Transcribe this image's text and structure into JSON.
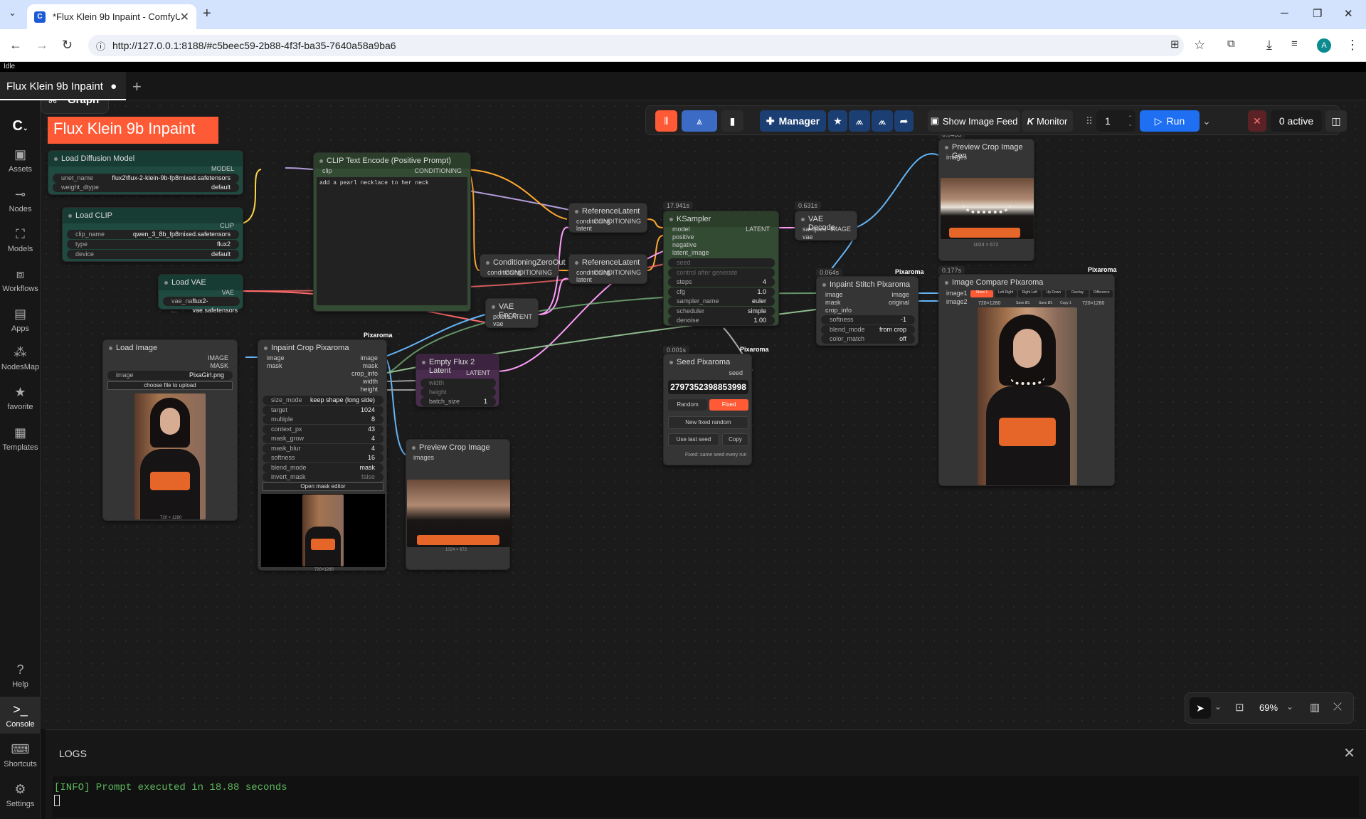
{
  "browser": {
    "tab_title": "*Flux Klein 9b Inpaint - ComfyU",
    "url": "http://127.0.0.1:8188/#c5beec59-2b88-4f3f-ba35-7640a58a9ba6",
    "profile": "A"
  },
  "status": "Idle",
  "workflow_tab": "Flux Klein 9b Inpaint",
  "sidebar": [
    {
      "label": "Assets",
      "icon": "image-icon"
    },
    {
      "label": "Nodes",
      "icon": "nodes-icon"
    },
    {
      "label": "Models",
      "icon": "models-icon"
    },
    {
      "label": "Workflows",
      "icon": "workflow-icon"
    },
    {
      "label": "Apps",
      "icon": "apps-icon"
    },
    {
      "label": "NodesMap",
      "icon": "map-icon"
    },
    {
      "label": "favorite",
      "icon": "star-icon"
    },
    {
      "label": "Templates",
      "icon": "template-icon"
    },
    {
      "label": "Help",
      "icon": "help-icon"
    },
    {
      "label": "Console",
      "icon": "console-icon"
    },
    {
      "label": "Shortcuts",
      "icon": "keyboard-icon"
    },
    {
      "label": "Settings",
      "icon": "settings-icon"
    }
  ],
  "graph_btn": "Graph",
  "title_banner": "Flux Klein 9b Inpaint",
  "toolbar": {
    "manager": "Manager",
    "image_feed": "Show Image Feed",
    "monitor": "Monitor",
    "queue_count": "1",
    "run": "Run",
    "active": "0 active"
  },
  "zoom": "69%",
  "nodes": {
    "load_diffusion": {
      "title": "Load Diffusion Model",
      "out": "MODEL",
      "w1": [
        "unet_name",
        "flux2\\flux-2-klein-9b-fp8mixed.safetensors"
      ],
      "w2": [
        "weight_dtype",
        "default"
      ]
    },
    "load_clip": {
      "title": "Load CLIP",
      "out": "CLIP",
      "w1": [
        "clip_name",
        "qwen_3_8b_fp8mixed.safetensors"
      ],
      "w2": [
        "type",
        "flux2"
      ],
      "w3": [
        "device",
        "default"
      ]
    },
    "load_vae": {
      "title": "Load VAE",
      "out": "VAE",
      "w1": [
        "vae_na ...",
        "flux2-vae.safetensors"
      ]
    },
    "clip_text": {
      "title": "CLIP Text Encode (Positive Prompt)",
      "in": "clip",
      "out": "CONDITIONING",
      "prompt": "add a pearl necklace to her neck"
    },
    "ref_latent1": {
      "title": "ReferenceLatent",
      "in1": "conditioning",
      "out": "CONDITIONING",
      "in2": "latent"
    },
    "ref_latent2": {
      "title": "ReferenceLatent",
      "in1": "conditioning",
      "out": "CONDITIONING",
      "in2": "latent"
    },
    "cond_zero": {
      "title": "ConditioningZeroOut",
      "in": "conditioning",
      "out": "CONDITIONING"
    },
    "vae_encode": {
      "title": "VAE Enco...",
      "in1": "pixels",
      "in2": "vae",
      "out": "LATENT"
    },
    "ksampler": {
      "title": "KSampler",
      "time": "17.941s",
      "ins": [
        "model",
        "positive",
        "negative",
        "latent_image"
      ],
      "out": "LATENT",
      "seed": "seed",
      "control": "control after generate",
      "steps": [
        "steps",
        "4"
      ],
      "cfg": [
        "cfg",
        "1.0"
      ],
      "sampler": [
        "sampler_name",
        "euler"
      ],
      "scheduler": [
        "scheduler",
        "simple"
      ],
      "denoise": [
        "denoise",
        "1.00"
      ]
    },
    "vae_decode": {
      "title": "VAE Decode",
      "time": "0.631s",
      "in1": "samples",
      "in2": "vae",
      "out": "IMAGE"
    },
    "preview_gen": {
      "title": "Preview Crop Image Gen",
      "time": "0.049s",
      "in": "images",
      "caption": "1024 × 672"
    },
    "stitch": {
      "title": "Inpaint Stitch Pixaroma",
      "time": "0.064s",
      "badge": "Pixaroma",
      "ins": [
        "image",
        "mask",
        "crop_info"
      ],
      "outs": [
        "image",
        "original"
      ],
      "softness": [
        "softness",
        "-1"
      ],
      "blend": [
        "blend_mode",
        "from crop"
      ],
      "color": [
        "color_match",
        "off"
      ]
    },
    "compare": {
      "title": "Image Compare Pixaroma",
      "time": "0.177s",
      "badge": "Pixaroma",
      "in1": "image1",
      "in2": "image2",
      "btns": [
        "Show 1",
        "Left Right",
        "Right Left",
        "Up Down",
        "Overlay",
        "Difference"
      ],
      "size1": "720×1280",
      "size2": "720×1280",
      "save1": "Save Ø1",
      "save2": "Save Ø1",
      "copy": "Copy 1"
    },
    "load_image": {
      "title": "Load Image",
      "outs": [
        "IMAGE",
        "MASK"
      ],
      "image": [
        "image",
        "PixaGirl.png"
      ],
      "upload": "choose file to upload",
      "caption": "720 × 1280"
    },
    "crop": {
      "title": "Inpaint Crop Pixaroma",
      "badge": "Pixaroma",
      "ins": [
        "image",
        "mask"
      ],
      "outs": [
        "image",
        "mask",
        "crop_info",
        "width",
        "height"
      ],
      "widgets": [
        [
          "size_mode",
          "keep shape (long side)"
        ],
        [
          "target",
          "1024"
        ],
        [
          "multiple",
          "8"
        ],
        [
          "context_px",
          "43"
        ],
        [
          "mask_grow",
          "4"
        ],
        [
          "mask_blur",
          "4"
        ],
        [
          "softness",
          "16"
        ],
        [
          "blend_mode",
          "mask"
        ],
        [
          "invert_mask",
          "false"
        ]
      ],
      "editor": "Open mask editor",
      "caption": "720×1280"
    },
    "empty_latent": {
      "title": "Empty Flux 2 Latent",
      "out": "LATENT",
      "in1": "width",
      "in2": "height",
      "batch": [
        "batch_size",
        "1"
      ]
    },
    "seed": {
      "title": "Seed Pixaroma",
      "time": "0.001s",
      "badge": "Pixaroma",
      "out": "seed",
      "value": "2797352398853998",
      "random": "Random",
      "fixed": "Fixed",
      "new": "New fixed random",
      "last": "Use last seed",
      "copy": "Copy",
      "note": "Fixed: same seed every run"
    },
    "preview_crop": {
      "title": "Preview Crop Image",
      "in": "images",
      "caption": "1024 × 672"
    }
  },
  "logs": {
    "title": "LOGS",
    "line": "[INFO] Prompt executed in 18.88 seconds"
  },
  "colors": {
    "accent": "#ff5a36",
    "run": "#1e6ff2",
    "model": "#b39ddb",
    "clip": "#ffd54a",
    "vae": "#ff6b6b",
    "cond": "#ffa931",
    "latent": "#ff9cf9",
    "image": "#64b5f6",
    "mask": "#81c784"
  }
}
